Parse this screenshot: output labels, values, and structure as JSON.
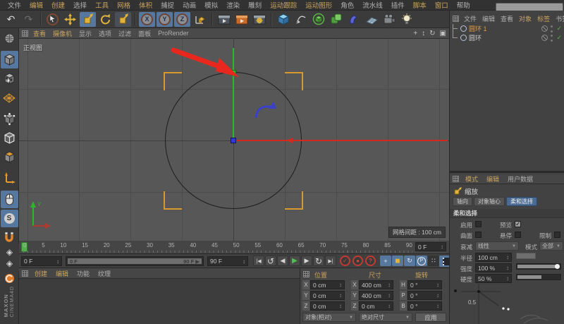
{
  "colors": {
    "accent_gold": "#c9a35e",
    "selection_orange": "#e09a3e",
    "highlight_blue": "#56789f",
    "tab_active_blue": "#4a6b94",
    "axis_green": "#2db52d",
    "axis_red": "#d42a1e",
    "axis_blue": "#2f3bd4",
    "bracket_orange": "#d7992e",
    "annotation_red": "#e8281e",
    "check_green": "#58b548",
    "record_red": "#c23a30",
    "marker_green": "#54b14e"
  },
  "menubar": {
    "items": [
      {
        "label": "文件"
      },
      {
        "label": "编辑"
      },
      {
        "label": "创建"
      },
      {
        "label": "选择"
      },
      {
        "label": "工具"
      },
      {
        "label": "网格"
      },
      {
        "label": "体积"
      },
      {
        "label": "捕捉"
      },
      {
        "label": "动画"
      },
      {
        "label": "模拟"
      },
      {
        "label": "渲染"
      },
      {
        "label": "雕刻"
      },
      {
        "label": "运动跟踪"
      },
      {
        "label": "运动图形"
      },
      {
        "label": "角色"
      },
      {
        "label": "流水线"
      },
      {
        "label": "插件"
      },
      {
        "label": "脚本"
      },
      {
        "label": "窗口"
      },
      {
        "label": "帮助"
      }
    ]
  },
  "toolbar": {
    "axis_labels": [
      "X",
      "Y",
      "Z"
    ],
    "undo_glyph": "↶",
    "redo_glyph": "↷",
    "icons": [
      "undo",
      "redo",
      "live-selection",
      "move-tool",
      "scale-tool",
      "rotate-tool",
      "last-used-tool-scale",
      "axis-x",
      "axis-y",
      "axis-z",
      "coordinate-system",
      "render-view",
      "render-to-picture-viewer",
      "render-settings",
      "add-cube",
      "spline-pen",
      "subdivision-surface",
      "array-generator",
      "deformer",
      "environment-floor",
      "camera",
      "light"
    ]
  },
  "left_palette": {
    "snap_glyph": "S",
    "lattice_glyph": "◈",
    "icons": [
      "make-editable",
      "model-mode",
      "texture-mode",
      "workplane-mode",
      "points-mode",
      "edges-mode",
      "polygons-mode",
      "enable-axis",
      "viewport-solo",
      "snap-mode",
      "magnet-snap"
    ]
  },
  "viewport": {
    "menu_items": [
      {
        "label": "查看"
      },
      {
        "label": "摄像机"
      },
      {
        "label": "显示"
      },
      {
        "label": "选项"
      },
      {
        "label": "过滤"
      },
      {
        "label": "面板"
      },
      {
        "label": "ProRender"
      }
    ],
    "view_icons": [
      {
        "name": "pan-view",
        "glyph": "+"
      },
      {
        "name": "dolly-view",
        "glyph": "↕"
      },
      {
        "name": "rotate-view",
        "glyph": "↻"
      },
      {
        "name": "toggle-view",
        "glyph": "▣"
      }
    ],
    "view_label": "正视图",
    "grid_spacing_label": "网格间距 : 100 cm",
    "gizmo_axis_label": "Y"
  },
  "timeline": {
    "ticks": [
      "0",
      "5",
      "10",
      "15",
      "20",
      "25",
      "30",
      "35",
      "40",
      "45",
      "50",
      "55",
      "60",
      "65",
      "70",
      "75",
      "80",
      "85",
      "90"
    ],
    "current_frame": "0 F",
    "start_field": "0 F",
    "end_field": "90 F",
    "range_start": "0 F",
    "range_end": "90 F ▶",
    "transport": [
      {
        "name": "go-to-start",
        "glyph": "|◀"
      },
      {
        "name": "play-reverse-loop",
        "glyph": "↺"
      },
      {
        "name": "previous-key",
        "glyph": "◀"
      },
      {
        "name": "play-forward",
        "glyph": "▶"
      },
      {
        "name": "next-frame",
        "glyph": "▶"
      },
      {
        "name": "loop-playback",
        "glyph": "↻"
      },
      {
        "name": "go-to-end",
        "glyph": "▶|"
      }
    ],
    "record": [
      {
        "name": "record-keyframe",
        "glyph": "✓"
      },
      {
        "name": "autokeying",
        "glyph": "●"
      },
      {
        "name": "keyframe-options",
        "glyph": "?"
      }
    ],
    "toggles": [
      {
        "name": "key-position",
        "glyph": "+"
      },
      {
        "name": "key-scale",
        "glyph": "◼"
      },
      {
        "name": "key-rotation",
        "glyph": "↻"
      },
      {
        "name": "key-parameter",
        "glyph": "P"
      },
      {
        "name": "key-point-level-animation",
        "glyph": "∷"
      }
    ]
  },
  "object_manager": {
    "menu_items": [
      {
        "label": "文件"
      },
      {
        "label": "编辑"
      },
      {
        "label": "查看"
      },
      {
        "label": "对象"
      },
      {
        "label": "标签"
      },
      {
        "label": "书签"
      }
    ],
    "objects": [
      {
        "name": "圆环 1",
        "selected": true
      },
      {
        "name": "圆环",
        "selected": false
      }
    ]
  },
  "attribute_manager": {
    "menu_items": [
      {
        "label": "模式"
      },
      {
        "label": "编辑"
      },
      {
        "label": "用户数据"
      }
    ],
    "tool_title": "缩放",
    "tabs": [
      {
        "label": "轴向"
      },
      {
        "label": "对象轴心"
      },
      {
        "label": "柔和选择"
      }
    ],
    "section_title": "柔和选择",
    "checkboxes": [
      {
        "label": "启用",
        "checked": false
      },
      {
        "label": "预览",
        "checked": true
      },
      {
        "label": "曲面",
        "checked": false
      },
      {
        "label": "悬停",
        "checked": false
      },
      {
        "label": "限制",
        "checked": false
      }
    ],
    "dropdowns": [
      {
        "label": "衰减",
        "value": "线性"
      },
      {
        "label": "模式",
        "value": "全部"
      }
    ],
    "sliders": [
      {
        "label": "半径",
        "value": "100 cm"
      },
      {
        "label": "强度",
        "value": "100 %"
      },
      {
        "label": "硬度",
        "value": "50 %"
      }
    ],
    "curve_value_label": "0.5"
  },
  "coordinates": {
    "headers": [
      "位置",
      "尺寸",
      "旋转"
    ],
    "rows": [
      {
        "l1": "X",
        "v1": "0 cm",
        "l2": "X",
        "v2": "400 cm",
        "l3": "H",
        "v3": "0 °"
      },
      {
        "l1": "Y",
        "v1": "0 cm",
        "l2": "Y",
        "v2": "400 cm",
        "l3": "P",
        "v3": "0 °"
      },
      {
        "l1": "Z",
        "v1": "0 cm",
        "l2": "Z",
        "v2": "0 cm",
        "l3": "B",
        "v3": "0 °"
      }
    ],
    "dropdown1": "对象(相对)",
    "dropdown2": "绝对尺寸",
    "apply_button": "应用"
  },
  "material_manager": {
    "menu_items": [
      {
        "label": "创建"
      },
      {
        "label": "编辑"
      },
      {
        "label": "功能"
      },
      {
        "label": "纹理"
      }
    ]
  },
  "branding": {
    "line1": "MAXON",
    "line2": "CINEMA4D"
  }
}
